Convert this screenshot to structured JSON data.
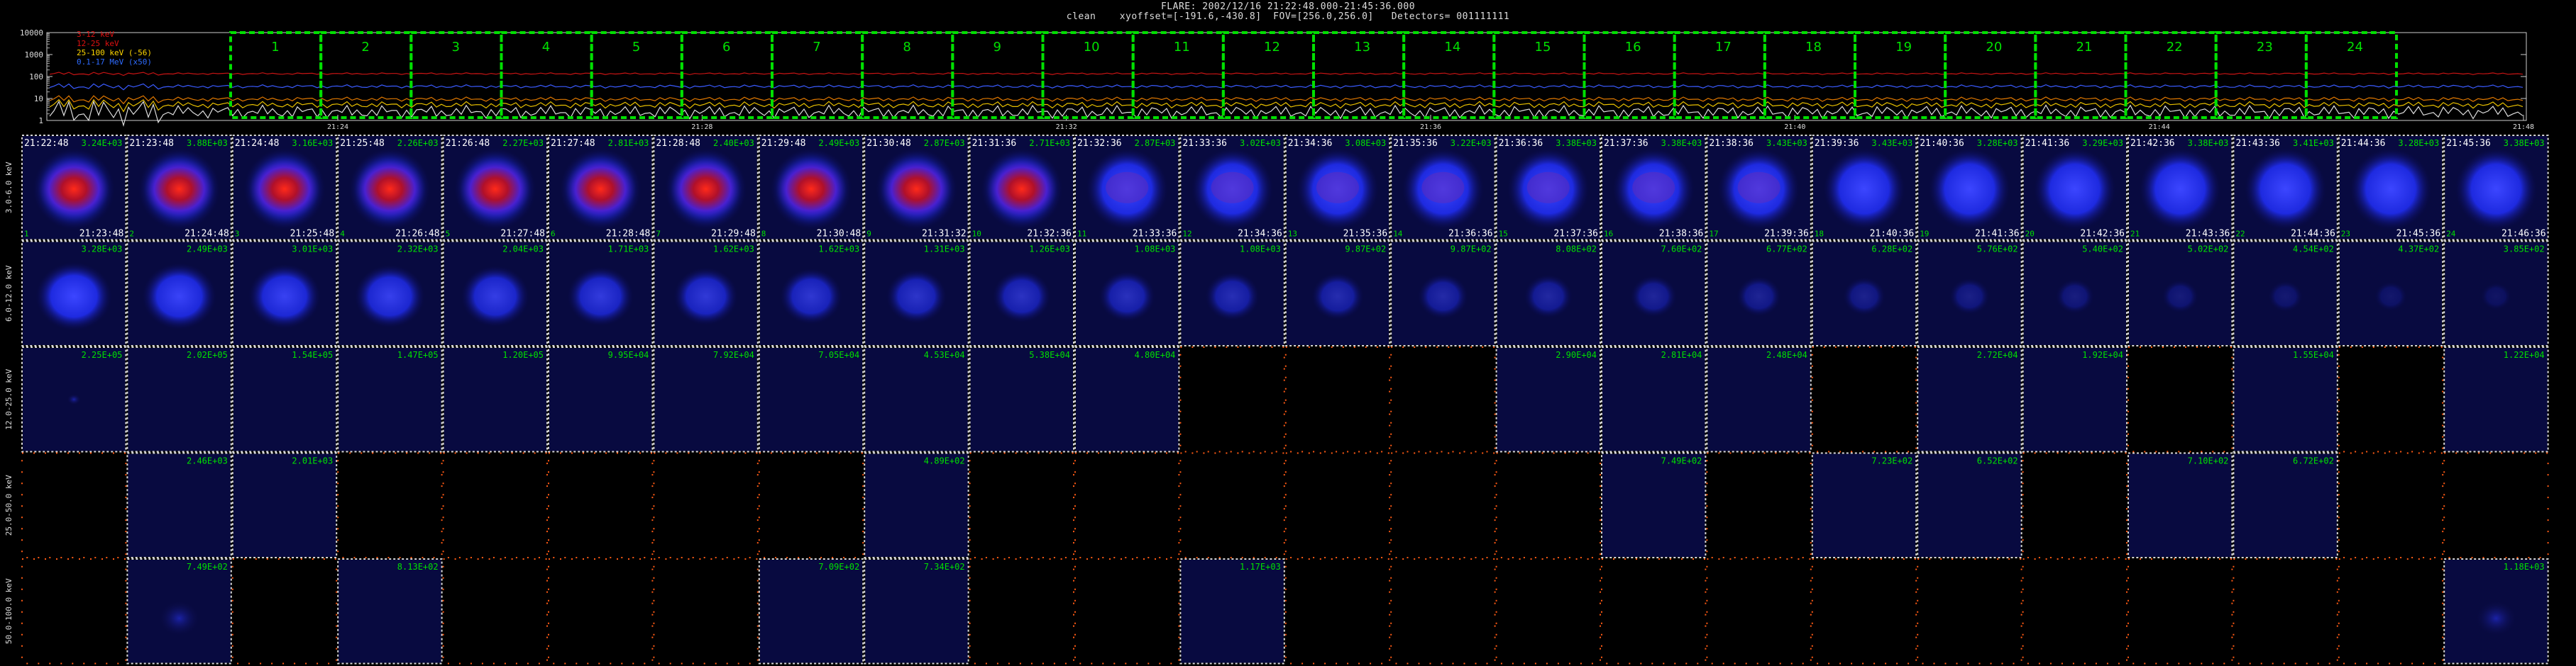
{
  "header": {
    "line1": "FLARE: 2002/12/16 21:22:48.000-21:45:36.000",
    "line2": "clean    xyoffset=[-191.6,-430.8]  FOV=[256.0,256.0]   Detectors= 001111111"
  },
  "lightcurve": {
    "ytick_labels": [
      "10000",
      "1000",
      "100",
      "10",
      "1"
    ],
    "legend": [
      {
        "text": "3-12 keV",
        "color": "#e01010"
      },
      {
        "text": "12-25 keV",
        "color": "#e01010"
      },
      {
        "text": "25-100 keV (-56)",
        "color": "#ffd700"
      },
      {
        "text": "0.1-17 MeV (x50)",
        "color": "#2e6bff"
      }
    ],
    "time_labels": [
      "21:24",
      "21:28",
      "21:32",
      "21:36",
      "21:40",
      "21:44",
      "21:48"
    ],
    "interval_numbers": [
      "1",
      "2",
      "3",
      "4",
      "5",
      "6",
      "7",
      "8",
      "9",
      "10",
      "11",
      "12",
      "13",
      "14",
      "15",
      "16",
      "17",
      "18",
      "19",
      "20",
      "21",
      "22",
      "23",
      "24"
    ],
    "colors": {
      "red": "#c81414",
      "blue": "#3a5bff",
      "yellow": "#e8c000",
      "orange": "#e07800",
      "white": "#dddddd",
      "green": "#00e000"
    }
  },
  "grid": {
    "row_labels": [
      "3.0-6.0 keV",
      "6.0-12.0 keV",
      "12.0-25.0 keV",
      "25.0-50.0 keV",
      "50.0-100.0 keV"
    ],
    "start_times": [
      "21:22:48",
      "21:23:48",
      "21:24:48",
      "21:25:48",
      "21:26:48",
      "21:27:48",
      "21:28:48",
      "21:29:48",
      "21:30:48",
      "21:31:36",
      "21:32:36",
      "21:33:36",
      "21:34:36",
      "21:35:36",
      "21:36:36",
      "21:37:36",
      "21:38:36",
      "21:39:36",
      "21:40:36",
      "21:41:36",
      "21:42:36",
      "21:43:36",
      "21:44:36",
      "21:45:36"
    ],
    "end_times": [
      "21:23:48",
      "21:24:48",
      "21:25:48",
      "21:26:48",
      "21:27:48",
      "21:28:48",
      "21:29:48",
      "21:30:48",
      "21:31:32",
      "21:32:36",
      "21:33:36",
      "21:34:36",
      "21:35:36",
      "21:36:36",
      "21:37:36",
      "21:38:36",
      "21:39:36",
      "21:40:36",
      "21:41:36",
      "21:42:36",
      "21:43:36",
      "21:44:36",
      "21:45:36",
      "21:46:36"
    ],
    "peaks": [
      [
        "3.24E+03",
        "3.88E+03",
        "3.16E+03",
        "2.26E+03",
        "2.27E+03",
        "2.81E+03",
        "2.40E+03",
        "2.49E+03",
        "2.87E+03",
        "2.71E+03",
        "2.87E+03",
        "3.02E+03",
        "3.08E+03",
        "3.22E+03",
        "3.38E+03",
        "3.38E+03",
        "3.43E+03",
        "3.43E+03",
        "3.28E+03",
        "3.29E+03",
        "3.38E+03",
        "3.41E+03",
        "3.28E+03",
        "3.38E+03"
      ],
      [
        "3.28E+03",
        "2.49E+03",
        "3.01E+03",
        "2.32E+03",
        "2.04E+03",
        "1.71E+03",
        "1.62E+03",
        "1.62E+03",
        "1.31E+03",
        "1.26E+03",
        "1.08E+03",
        "1.08E+03",
        "9.87E+02",
        "9.87E+02",
        "8.08E+02",
        "7.60E+02",
        "6.77E+02",
        "6.28E+02",
        "5.76E+02",
        "5.40E+02",
        "5.02E+02",
        "4.54E+02",
        "4.37E+02",
        "3.85E+02"
      ],
      [
        "2.25E+05",
        "2.02E+05",
        "1.54E+05",
        "1.47E+05",
        "1.20E+05",
        "9.95E+04",
        "7.92E+04",
        "7.05E+04",
        "4.53E+04",
        "5.38E+04",
        "4.80E+04",
        "",
        "",
        "",
        "2.90E+04",
        "2.81E+04",
        "2.48E+04",
        "",
        "2.72E+04",
        "1.92E+04",
        "",
        "1.55E+04",
        "",
        "1.22E+04"
      ],
      [
        "",
        "2.46E+03",
        "2.01E+03",
        "",
        "",
        "",
        "",
        "",
        "4.89E+02",
        "",
        "",
        "",
        "",
        "",
        "",
        "7.49E+02",
        "",
        "7.23E+02",
        "6.52E+02",
        "",
        "7.10E+02",
        "6.72E+02",
        "",
        ""
      ],
      [
        "",
        "7.49E+02",
        "",
        "8.13E+02",
        "",
        "",
        "",
        "7.09E+02",
        "7.34E+02",
        "",
        "",
        "1.17E+03",
        "",
        "",
        "",
        "",
        "",
        "",
        "",
        "",
        "",
        "",
        "",
        "1.18E+03"
      ]
    ],
    "orange_frame": [
      [
        false,
        false,
        false,
        false,
        false,
        false,
        false,
        false,
        false,
        false,
        false,
        false,
        false,
        false,
        false,
        false,
        false,
        false,
        false,
        false,
        false,
        false,
        false,
        false
      ],
      [
        false,
        false,
        false,
        false,
        false,
        false,
        false,
        false,
        false,
        false,
        false,
        false,
        false,
        false,
        false,
        false,
        false,
        false,
        false,
        false,
        false,
        false,
        false,
        false
      ],
      [
        false,
        false,
        false,
        false,
        false,
        false,
        false,
        false,
        false,
        false,
        false,
        true,
        true,
        true,
        false,
        false,
        false,
        true,
        false,
        false,
        true,
        false,
        true,
        false
      ],
      [
        true,
        false,
        false,
        true,
        true,
        true,
        true,
        true,
        false,
        true,
        true,
        true,
        true,
        true,
        true,
        false,
        true,
        false,
        false,
        true,
        false,
        false,
        true,
        true
      ],
      [
        true,
        false,
        true,
        false,
        true,
        true,
        true,
        false,
        false,
        true,
        true,
        false,
        true,
        true,
        true,
        true,
        true,
        true,
        true,
        true,
        true,
        true,
        true,
        false
      ]
    ],
    "colors": {
      "frame_white": "#d8d8d8",
      "frame_orange": "#ff5a14",
      "peak_text": "#00e000",
      "time_text": "#ffffff"
    }
  }
}
